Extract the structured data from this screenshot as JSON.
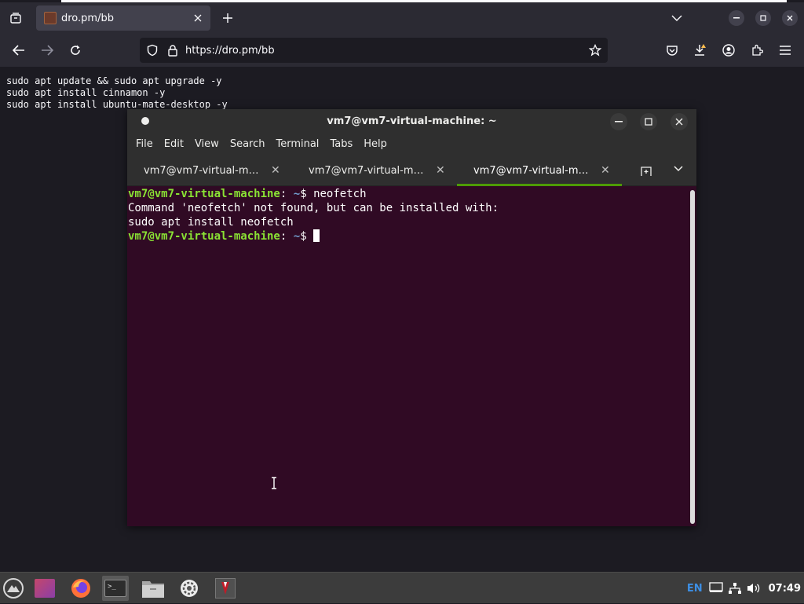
{
  "browser": {
    "tab_title": "dro.pm/bb",
    "url": "https://dro.pm/bb"
  },
  "page": {
    "lines": [
      "sudo apt update && sudo apt upgrade -y",
      "sudo apt install cinnamon -y",
      "sudo apt install ubuntu-mate-desktop -y"
    ]
  },
  "terminal": {
    "title": "vm7@vm7-virtual-machine: ~",
    "menu": [
      "File",
      "Edit",
      "View",
      "Search",
      "Terminal",
      "Tabs",
      "Help"
    ],
    "tabs": [
      {
        "label": "vm7@vm7-virtual-machine: ~",
        "active": false
      },
      {
        "label": "vm7@vm7-virtual-machine: ~",
        "active": false
      },
      {
        "label": "vm7@vm7-virtual-machine: ~",
        "active": true
      }
    ],
    "prompt_user": "vm7@vm7-virtual-machine",
    "prompt_sep": ":",
    "prompt_path": "~",
    "prompt_symbol": "$",
    "command": "neofetch",
    "output_lines": [
      "Command 'neofetch' not found, but can be installed with:",
      "sudo apt install neofetch"
    ]
  },
  "taskbar": {
    "apps": [
      "menu-icon",
      "workspace-icon",
      "firefox-icon",
      "terminal-icon",
      "files-icon",
      "settings-icon",
      "app-icon"
    ],
    "lang": "EN",
    "clock": "07:49"
  }
}
